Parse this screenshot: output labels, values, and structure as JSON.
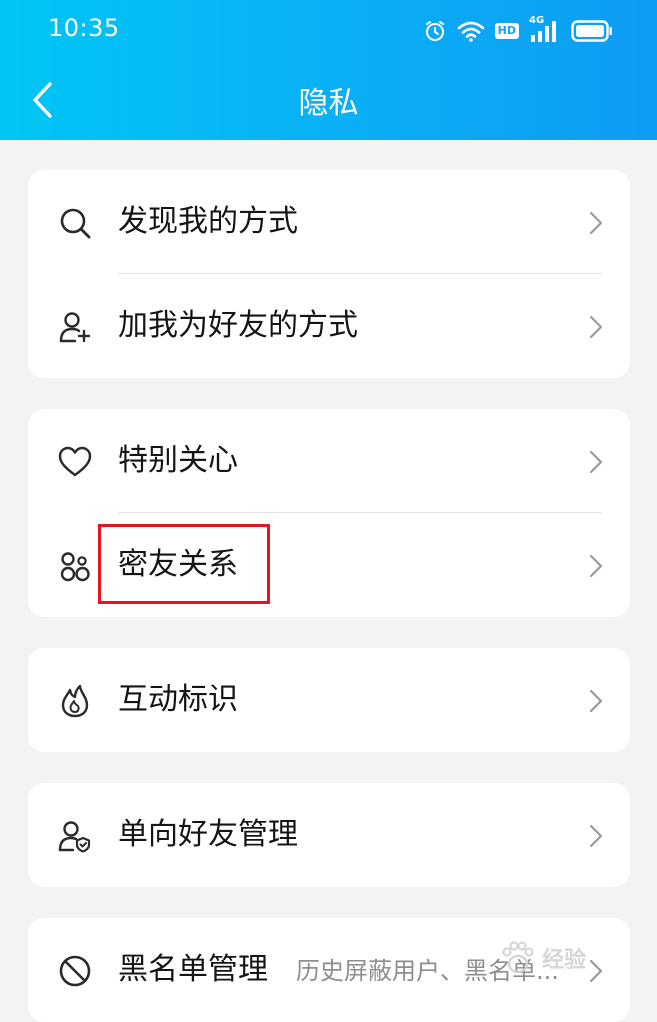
{
  "status_bar": {
    "time": "10:35",
    "hd_label": "HD",
    "network_label": "4G"
  },
  "nav": {
    "title": "隐私",
    "back_icon": "chevron-left-icon"
  },
  "groups": [
    {
      "items": [
        {
          "label": "发现我的方式",
          "icon": "search-icon"
        },
        {
          "label": "加我为好友的方式",
          "icon": "add-user-icon"
        }
      ]
    },
    {
      "items": [
        {
          "label": "特别关心",
          "icon": "heart-icon"
        },
        {
          "label": "密友关系",
          "icon": "close-friends-icon",
          "highlighted": true
        }
      ]
    },
    {
      "items": [
        {
          "label": "互动标识",
          "icon": "flame-icon"
        }
      ]
    },
    {
      "items": [
        {
          "label": "单向好友管理",
          "icon": "user-shield-icon"
        }
      ]
    },
    {
      "items": [
        {
          "label": "黑名单管理",
          "icon": "block-icon",
          "subtitle": "历史屏蔽用户、黑名单..."
        }
      ]
    }
  ],
  "watermark": {
    "text": "经验"
  },
  "colors": {
    "header_start": "#00c6f5",
    "header_end": "#0e9cf4",
    "highlight": "#e3151e",
    "background": "#f3f3f3"
  }
}
